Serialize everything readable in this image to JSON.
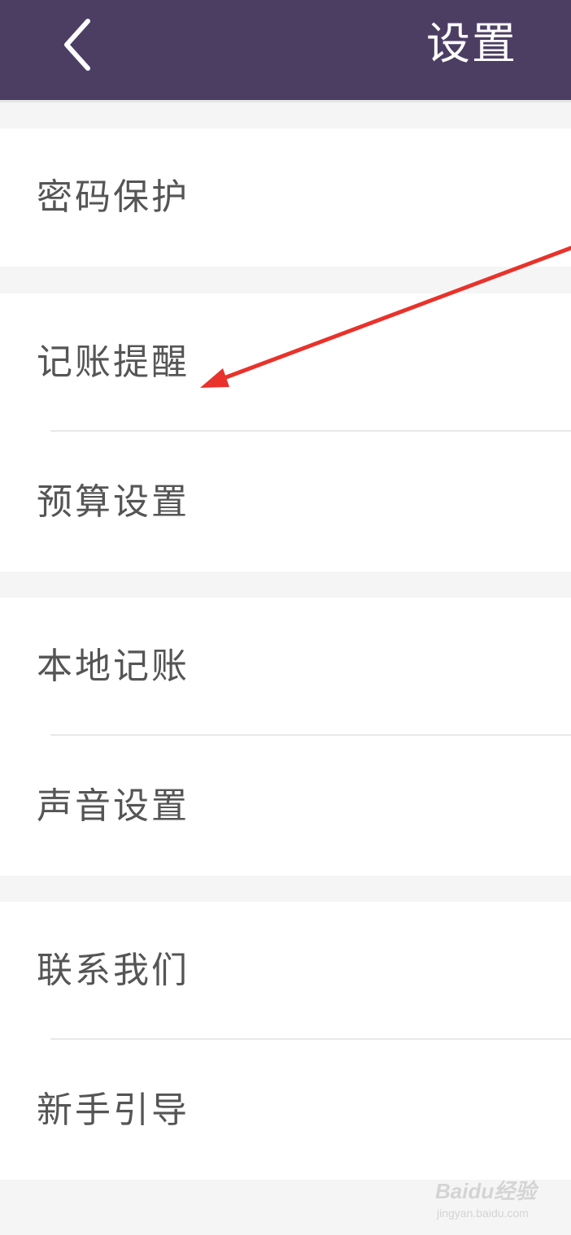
{
  "header": {
    "title": "设置",
    "back_icon": "chevron-left-icon",
    "background": "#4c3e63"
  },
  "groups": [
    {
      "items": [
        {
          "label": "密码保护"
        }
      ]
    },
    {
      "items": [
        {
          "label": "记账提醒"
        },
        {
          "label": "预算设置"
        }
      ]
    },
    {
      "items": [
        {
          "label": "本地记账"
        },
        {
          "label": "声音设置"
        }
      ]
    },
    {
      "items": [
        {
          "label": "联系我们"
        },
        {
          "label": "新手引导"
        }
      ]
    }
  ],
  "annotation": {
    "type": "arrow",
    "color": "#e8322b",
    "points_to": "记账提醒"
  },
  "watermark": {
    "logo": "Baidu经验",
    "sub": "jingyan.baidu.com"
  }
}
